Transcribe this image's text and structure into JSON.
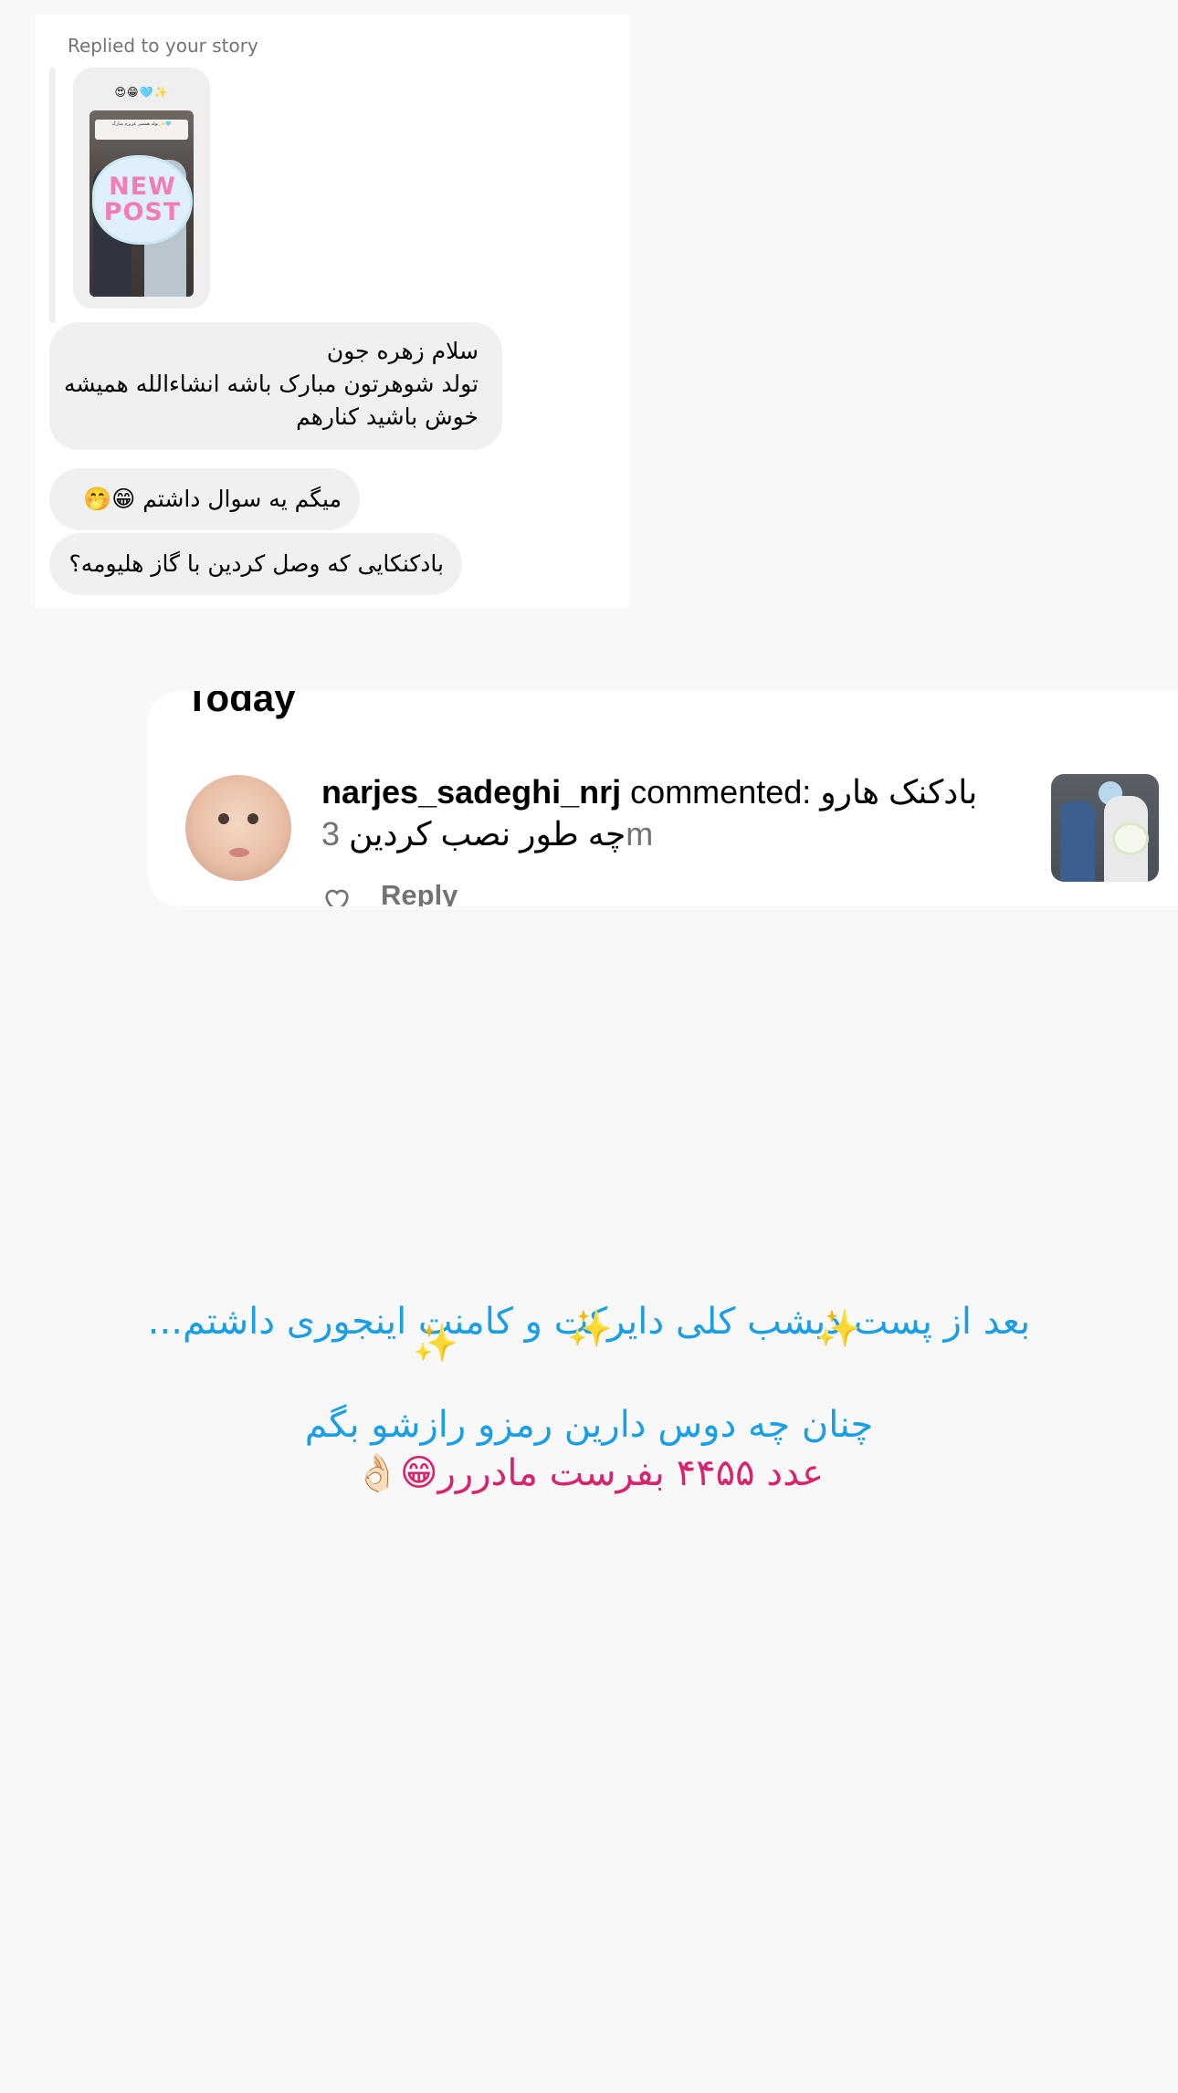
{
  "dm": {
    "replied_label": "Replied to your story",
    "story_emojis": "😍😁🩵✨",
    "story_caption": "تولد همسر عزیزم مبارک ✨🩵",
    "sticker_line1": "NEW",
    "sticker_line2": "POST",
    "messages": [
      {
        "lines": [
          "سلام زهره جون",
          "تولد شوهرتون مبارک باشه انشاءالله همیشه",
          "خوش باشید کنارهم"
        ]
      },
      {
        "text": "میگم یه سوال داشتم 😁🤭"
      },
      {
        "text": "بادکنکایی که وصل کردین با گاز هلیومه؟"
      }
    ]
  },
  "notification": {
    "section_heading": "Today",
    "username": "narjes_sadeghi_nrj",
    "action": "commented:",
    "comment_line1": "بادکنک هارو",
    "comment_line2": "چه طور نصب کردین",
    "time": "3m",
    "reply_label": "Reply",
    "heart_icon": "heart-outline-icon"
  },
  "overlay": {
    "line1": "بعد از پست دیشب کلی دایرکت و کامنت اینجوری داشتم...",
    "line2": "چنان چه دوس دارین رمزو رازشو بگم",
    "line3": "عدد ۴۴۵۵  بفرست مادررر😁👌🏻",
    "sparkle": "✨",
    "colors": {
      "blue": "#1a9fe4",
      "pink": "#d6246f",
      "sparkle": "#f3c623"
    }
  }
}
